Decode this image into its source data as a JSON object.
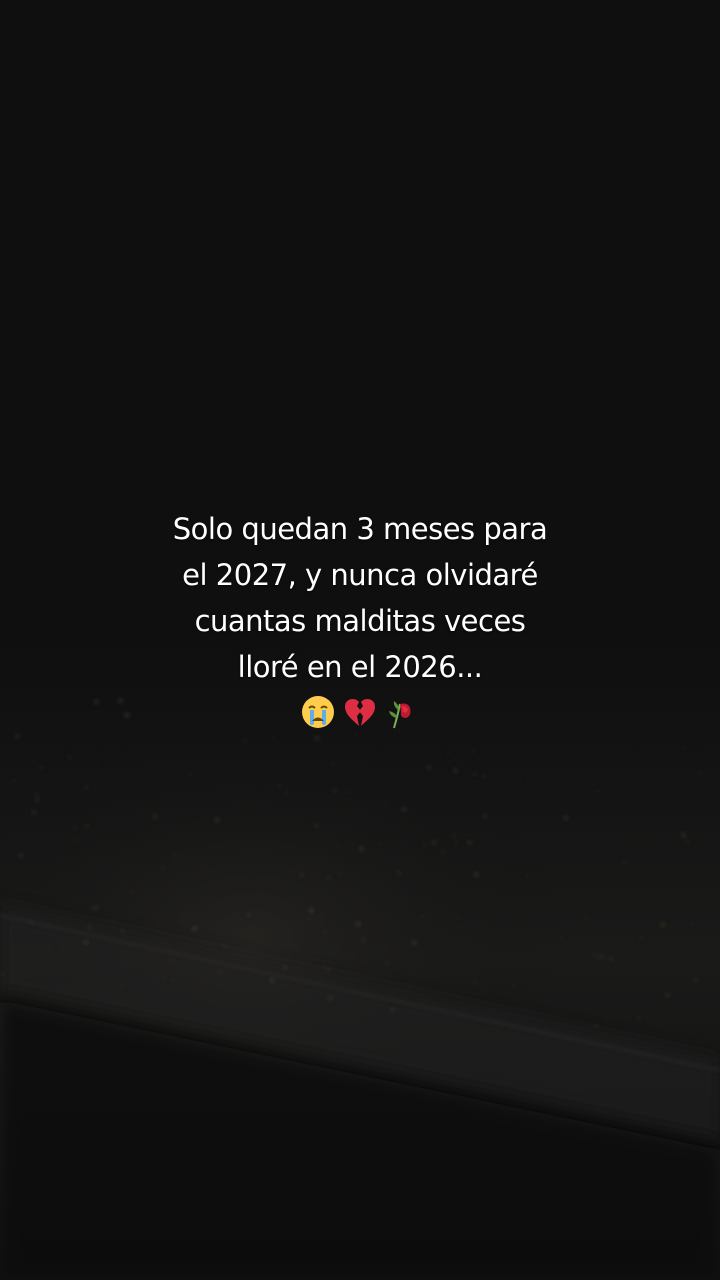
{
  "caption": {
    "lines": [
      "Solo quedan 3 meses para",
      "el 2027, y nunca olvidaré",
      "cuantas malditas veces",
      "lloré en el 2026..."
    ],
    "emojis": [
      "crying-face-icon",
      "broken-heart-icon",
      "wilted-rose-icon"
    ]
  },
  "colors": {
    "background": "#0e0e0e",
    "text": "#ffffff",
    "city_lights": "#5a5040"
  }
}
